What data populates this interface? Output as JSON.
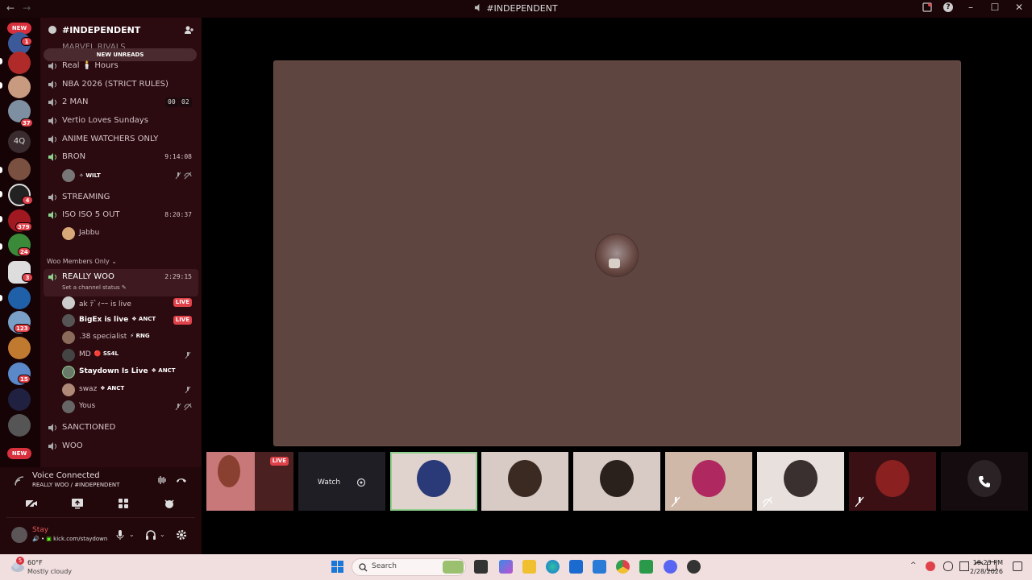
{
  "window": {
    "title": "#INDEPENDENT"
  },
  "rail": {
    "new_top": "NEW",
    "new_bottom": "NEW",
    "text_server": "4Q",
    "badges": [
      "1",
      "37",
      "4",
      "379",
      "24",
      "3",
      "123",
      "15"
    ]
  },
  "guild": {
    "name": "#INDEPENDENT",
    "new_unreads": "NEW UNREADS",
    "cut_channel": "MARVEL RIVALS"
  },
  "channels": {
    "real_hours": "Real 🕯️ Hours",
    "nba": "NBA 2026 (STRICT RULES)",
    "two_man": "2 MAN",
    "two_man_count_a": "00",
    "two_man_count_b": "02",
    "vertio": "Vertio Loves Sundays",
    "anime": "ANIME WATCHERS ONLY",
    "bron": "BRON",
    "bron_timer": "9:14:08",
    "bron_user": "WILT",
    "streaming": "STREAMING",
    "iso": "ISO ISO 5 OUT",
    "iso_timer": "8:20:37",
    "iso_user": "Jabbu",
    "category": "Woo Members Only",
    "really_woo": "REALLY WOO",
    "really_woo_timer": "2:29:15",
    "really_woo_status": "Set a channel status",
    "sanctioned": "SANCTIONED",
    "woo": "WOO"
  },
  "woo_users": [
    {
      "name": "ak ﾃﾞｨｰｰ is live",
      "tag": "",
      "live": "LIVE"
    },
    {
      "name": "BigEx is live",
      "tag": "ANCT",
      "live": "LIVE"
    },
    {
      "name": ".38 specialist",
      "tag": "RNG",
      "live": ""
    },
    {
      "name": "MD",
      "tag": "SS4L",
      "live": ""
    },
    {
      "name": "Staydown Is Live",
      "tag": "ANCT",
      "live": ""
    },
    {
      "name": "swaz",
      "tag": "ANCT",
      "live": ""
    },
    {
      "name": "Yous",
      "tag": "",
      "live": ""
    }
  ],
  "panel": {
    "voice_connected": "Voice Connected",
    "voice_location": "REALLY WOO / #INDEPENDENT",
    "username": "Stay",
    "user_status": "kick.com/staydown"
  },
  "tiles": {
    "live_label": "LIVE",
    "watch_label": "Watch"
  },
  "taskbar": {
    "temperature": "60°F",
    "weather": "Mostly cloudy",
    "weather_badge": "5",
    "search_placeholder": "Search",
    "time": "10:23 PM",
    "date": "2/28/2026"
  },
  "colors": {
    "accent_live": "#e0424a",
    "sidebar_bg": "#2b0a10",
    "stage_card": "#5f4540",
    "selected_tile": "#8fd18f"
  }
}
